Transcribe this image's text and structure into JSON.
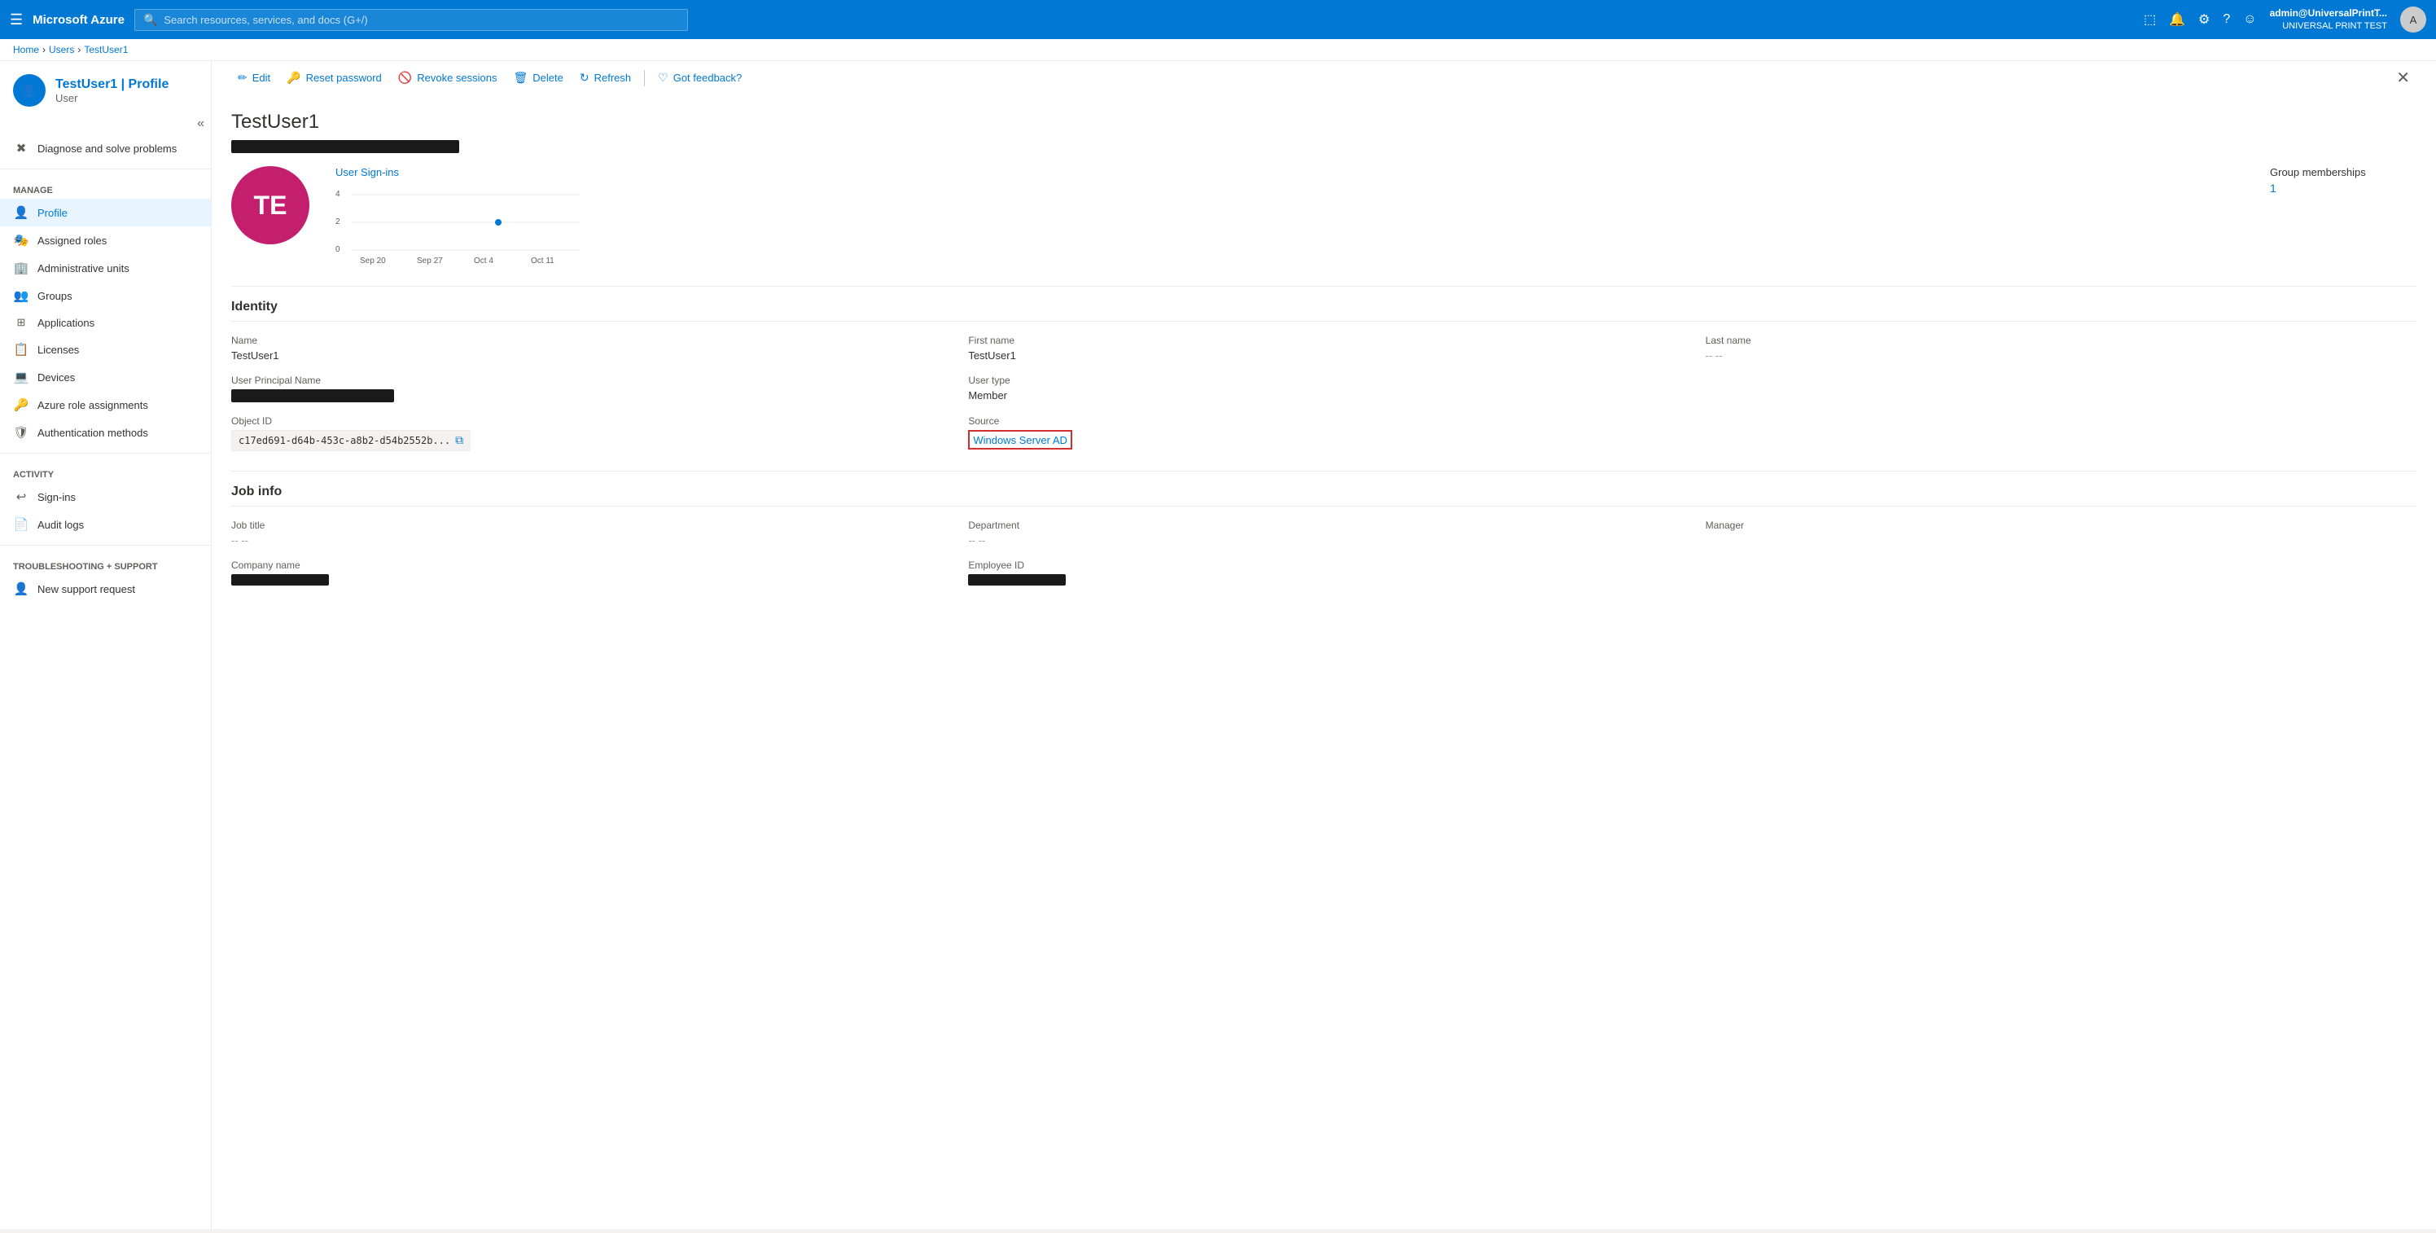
{
  "topnav": {
    "logo": "Microsoft Azure",
    "search_placeholder": "Search resources, services, and docs (G+/)",
    "user_display": "admin@UniversalPrintT...",
    "tenant": "UNIVERSAL PRINT TEST",
    "avatar_initials": "A"
  },
  "breadcrumb": {
    "items": [
      "Home",
      "Users",
      "TestUser1"
    ]
  },
  "sidebar": {
    "collapse_icon": "«",
    "user_label": "User",
    "diagnose_label": "Diagnose and solve problems",
    "manage_section": "Manage",
    "items": [
      {
        "id": "profile",
        "label": "Profile",
        "icon": "👤",
        "active": true
      },
      {
        "id": "assigned-roles",
        "label": "Assigned roles",
        "icon": "🎭"
      },
      {
        "id": "administrative-units",
        "label": "Administrative units",
        "icon": "🏢"
      },
      {
        "id": "groups",
        "label": "Groups",
        "icon": "👥"
      },
      {
        "id": "applications",
        "label": "Applications",
        "icon": "⊞"
      },
      {
        "id": "licenses",
        "label": "Licenses",
        "icon": "📋"
      },
      {
        "id": "devices",
        "label": "Devices",
        "icon": "💻"
      },
      {
        "id": "azure-role-assignments",
        "label": "Azure role assignments",
        "icon": "🔑"
      },
      {
        "id": "authentication-methods",
        "label": "Authentication methods",
        "icon": "🛡"
      }
    ],
    "activity_section": "Activity",
    "activity_items": [
      {
        "id": "sign-ins",
        "label": "Sign-ins",
        "icon": "↩"
      },
      {
        "id": "audit-logs",
        "label": "Audit logs",
        "icon": "📄"
      }
    ],
    "troubleshooting_section": "Troubleshooting + Support",
    "support_items": [
      {
        "id": "new-support-request",
        "label": "New support request",
        "icon": "👤"
      }
    ]
  },
  "page": {
    "username": "TestUser1",
    "subtitle": "| Profile",
    "avatar_initials": "TE",
    "toolbar": {
      "edit": "Edit",
      "reset_password": "Reset password",
      "revoke_sessions": "Revoke sessions",
      "delete": "Delete",
      "refresh": "Refresh",
      "feedback": "Got feedback?"
    },
    "chart": {
      "title": "User Sign-ins",
      "labels": [
        "Sep 20",
        "Sep 27",
        "Oct 4",
        "Oct 11"
      ],
      "y_labels": [
        "4",
        "2",
        "0"
      ]
    },
    "group_memberships": {
      "label": "Group memberships",
      "count": "1"
    },
    "identity": {
      "section_title": "Identity",
      "name_label": "Name",
      "name_value": "TestUser1",
      "first_name_label": "First name",
      "first_name_value": "TestUser1",
      "last_name_label": "Last name",
      "last_name_value": "-- --",
      "upn_label": "User Principal Name",
      "user_type_label": "User type",
      "user_type_value": "Member",
      "object_id_label": "Object ID",
      "object_id_value": "c17ed691-d64b-453c-a8b2-d54b2552b...",
      "source_label": "Source",
      "source_value": "Windows Server AD"
    },
    "job_info": {
      "section_title": "Job info",
      "job_title_label": "Job title",
      "job_title_value": "-- --",
      "department_label": "Department",
      "department_value": "-- --",
      "manager_label": "Manager",
      "company_name_label": "Company name",
      "employee_id_label": "Employee ID"
    }
  }
}
